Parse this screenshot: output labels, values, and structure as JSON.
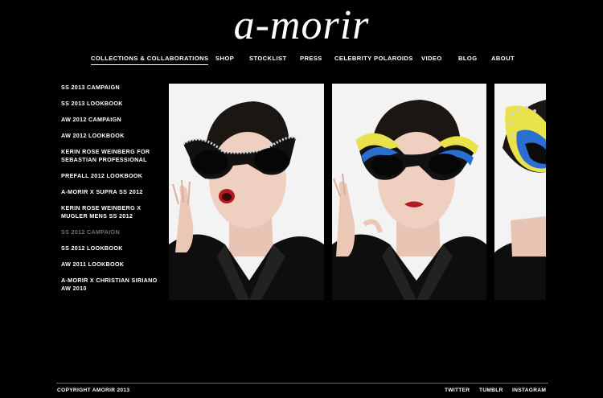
{
  "logo": "a-morir",
  "nav": [
    "COLLECTIONS & COLLABORATIONS",
    "SHOP",
    "STOCKLIST",
    "PRESS",
    "CELEBRITY POLAROIDS",
    "VIDEO",
    "BLOG",
    "ABOUT"
  ],
  "sidebar": [
    "SS 2013 CAMPAIGN",
    "SS 2013 LOOKBOOK",
    "AW 2012 CAMPAIGN",
    "AW 2012 LOOKBOOK",
    "KERIN ROSE WEINBERG FOR SEBASTIAN PROFESSIONAL",
    "PREFALL 2012 LOOKBOOK",
    "A-MORIR X SUPRA SS 2012",
    "KERIN ROSE WEINBERG X MUGLER MENS SS 2012",
    "SS 2012 CAMPAIGN",
    "SS 2012 LOOKBOOK",
    "AW 2011 LOOKBOOK",
    "A-MORIR X CHRISTIAN SIRIANO AW 2010"
  ],
  "sidebar_current": "SS 2012 CAMPAIGN",
  "footer": {
    "copyright": "COPYRIGHT AMORIR 2013",
    "links": [
      "TWITTER",
      "TUMBLR",
      "INSTAGRAM"
    ]
  },
  "gallery": {
    "images": [
      "model-sunglasses-rhinestone-photo",
      "model-sunglasses-blue-yellow-photo",
      "sunglasses-closeup-photo"
    ]
  },
  "colors": {
    "background": "#000000",
    "text": "#ffffff",
    "current": "#6e6e6e"
  }
}
